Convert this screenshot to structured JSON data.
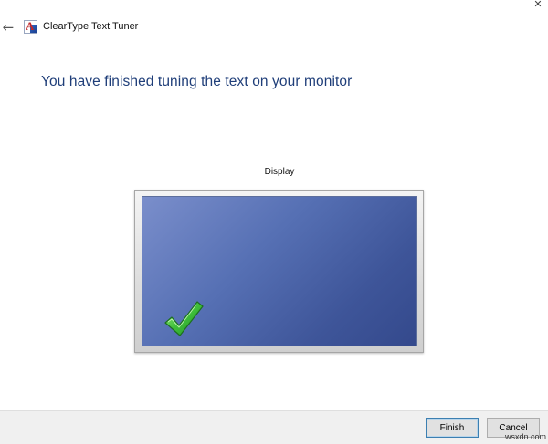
{
  "window": {
    "title": "ClearType Text Tuner",
    "back_glyph": "←",
    "close_glyph": "✕"
  },
  "main": {
    "heading": "You have finished tuning the text on your monitor",
    "display_label": "Display"
  },
  "buttons": {
    "finish": "Finish",
    "cancel": "Cancel"
  },
  "watermark": "wsxdn.com",
  "colors": {
    "heading": "#1f3e79",
    "screen_light": "#7a8ecb",
    "screen_dark": "#34498c",
    "check_green": "#2fa12f"
  },
  "icons": {
    "back": "back-arrow-icon",
    "app": "cleartype-app-icon",
    "close": "close-icon",
    "check": "checkmark-icon"
  }
}
